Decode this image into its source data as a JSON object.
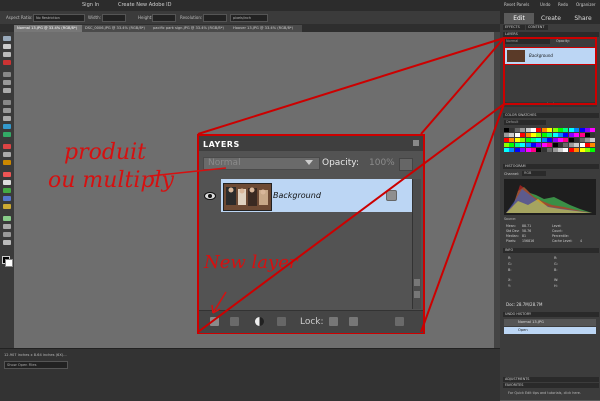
{
  "menubar": {
    "signin": "Sign In",
    "create_id": "Create New Adobe ID",
    "reset_panels": "Reset Panels",
    "undo": "Undo",
    "redo": "Redo",
    "organizer": "Organizer"
  },
  "options_bar": {
    "aspect_ratio_label": "Aspect Ratio:",
    "aspect_ratio_value": "No Restriction",
    "width_label": "Width:",
    "height_label": "Height:",
    "resolution_label": "Resolution:",
    "unit_value": "pixels/inch"
  },
  "document_tabs": [
    "Normal 13.JPG @ 33.4% (RGB/8*)",
    "DSC_0006.JPG @ 33.4% (RGB/8*)",
    "pacific park sign.JPG @ 33.4% (RGB/8*)",
    "Hoover 13.JPG @ 33.4% (RGB/8*)"
  ],
  "modes": {
    "edit": "Edit",
    "create": "Create",
    "share": "Share"
  },
  "status_bar": {
    "doc_size": "12.907 inches x 8.64 inches (6X)...",
    "dropdown": "Show Open Files"
  },
  "right_panels": {
    "effects": "EFFECTS",
    "content": "CONTENT",
    "layers": "LAYERS",
    "layers_blend": "Normal",
    "layers_opacity": "Opacity:",
    "layer_name": "Background",
    "lock_label": "Lock:",
    "color_swatches": "COLOR SWATCHES",
    "swatch_set": "Default",
    "histogram": "HISTOGRAM",
    "channel_label": "Channel:",
    "channel_value": "RGB",
    "source_label": "Source:",
    "mean_label": "Mean:",
    "mean_value": "88.71",
    "stddev_label": "Std Dev:",
    "stddev_value": "58.76",
    "median_label": "Median:",
    "median_value": "81",
    "pixels_label": "Pixels:",
    "pixels_value": "156816",
    "level_label": "Level:",
    "count_label": "Count:",
    "percentile_label": "Percentile:",
    "cache_label": "Cache Level:",
    "cache_value": "4",
    "info": "INFO",
    "doc_info": "Doc: 28.7M/28.7M",
    "undo_history": "UNDO HISTORY",
    "history_file": "Normal 13.JPG",
    "history_open": "Open",
    "adjustments": "ADJUSTMENTS",
    "favorites": "FAVORITES",
    "tips": "For Quick Edit tips and tutorials, click here."
  },
  "layers_zoom": {
    "title": "LAYERS",
    "blend_mode": "Normal",
    "opacity_label": "Opacity:",
    "opacity_value": "100%",
    "layer_name": "Background",
    "lock_label": "Lock:"
  },
  "annotations": {
    "produit": "produit",
    "ou_multiply": "ou multiply",
    "new_layer": "New layer"
  },
  "colors": {
    "annotation_red": "#d61010",
    "selected_layer": "#bcd6f4",
    "panel_bg": "#535353"
  }
}
